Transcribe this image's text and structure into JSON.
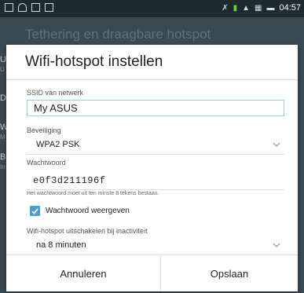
{
  "status_bar": {
    "time": "04:57",
    "icons": [
      "sim-icon",
      "wifi-icon",
      "file-icon",
      "message-icon",
      "mute-icon",
      "battery-saver-icon",
      "signal-icon",
      "sim-card-icon",
      "battery-icon"
    ]
  },
  "background": {
    "title": "Tethering en draagbare hotspot",
    "letters": [
      "U",
      "D",
      "W",
      "B"
    ],
    "subs": [
      "U",
      "M",
      "In"
    ]
  },
  "dialog": {
    "title": "Wifi-hotspot instellen",
    "ssid_label": "SSID van netwerk",
    "ssid_value": "My ASUS",
    "security_label": "Beveiliging",
    "security_value": "WPA2 PSK",
    "password_label": "Wachtwoord",
    "password_value": "e0f3d211196f",
    "password_hint": "Het wachtwoord moet uit ten minste 8 tekens bestaan.",
    "show_password_label": "Wachtwoord weergeven",
    "show_password_checked": true,
    "inactivity_label": "Wifi-hotspot uitschakelen bij inactiviteit",
    "inactivity_value": "na 8 minuten",
    "cancel_label": "Annuleren",
    "save_label": "Opslaan"
  }
}
